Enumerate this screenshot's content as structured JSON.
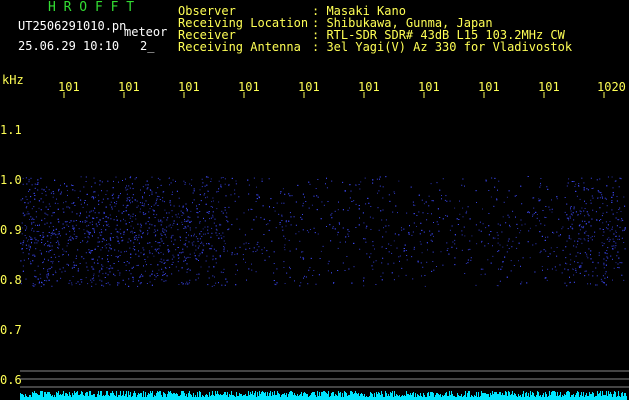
{
  "header": {
    "brand": "H R O F F T",
    "filename": "UT2506291010.pn",
    "event_label": "meteor",
    "datetime": "25.06.29 10:10",
    "count": "2_",
    "fields": [
      {
        "label": "Observer",
        "value": ": Masaki Kano"
      },
      {
        "label": "Receiving Location",
        "value": ": Shibukawa, Gunma, Japan"
      },
      {
        "label": "Receiver",
        "value": ": RTL-SDR SDR# 43dB L15 103.2MHz CW"
      },
      {
        "label": "Receiving Antenna",
        "value": ": 3el Yagi(V) Az 330 for Vladivostok"
      }
    ]
  },
  "axis": {
    "unit": "kHz",
    "time_ticks": [
      "101",
      "101",
      "101",
      "101",
      "101",
      "101",
      "101",
      "101",
      "101",
      "1020"
    ],
    "freq_ticks": [
      "1.1",
      "1.0",
      "0.9",
      "0.8",
      "0.7",
      "0.6"
    ]
  },
  "colors": {
    "header_text": "#ffff55",
    "brand": "#33dd33",
    "noise_band": "#3344ff",
    "signal_strip": "#00e5ff",
    "reference_line": "#888888"
  }
}
